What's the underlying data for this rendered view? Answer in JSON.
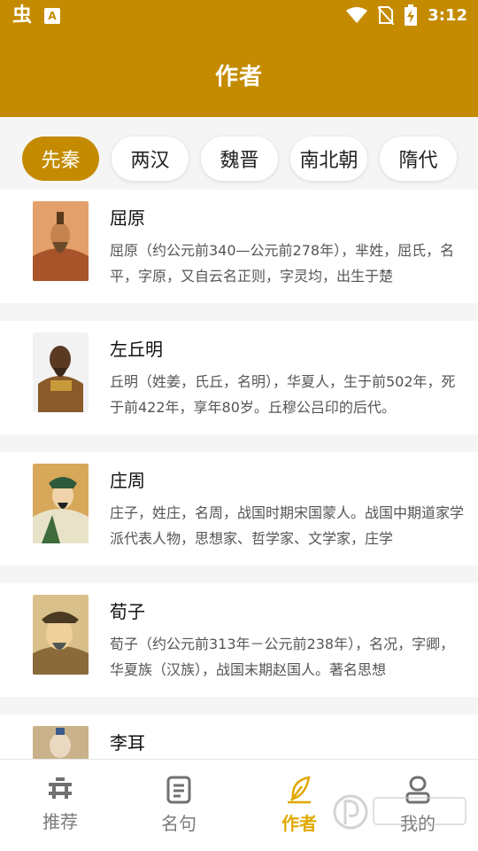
{
  "status_bar": {
    "time": "3:12",
    "badge": "A"
  },
  "header": {
    "title": "作者"
  },
  "dynasty_tabs": [
    {
      "label": "先秦",
      "active": true
    },
    {
      "label": "两汉",
      "active": false
    },
    {
      "label": "魏晋",
      "active": false
    },
    {
      "label": "南北朝",
      "active": false
    },
    {
      "label": "隋代",
      "active": false
    }
  ],
  "authors": [
    {
      "name": "屈原",
      "desc": "屈原（约公元前340—公元前278年），芈姓，屈氏，名平，字原，又自云名正则，字灵均，出生于楚"
    },
    {
      "name": "左丘明",
      "desc": "丘明（姓姜，氏丘，名明），华夏人，生于前502年，死于前422年，享年80岁。丘穆公吕印的后代。"
    },
    {
      "name": "庄周",
      "desc": "庄子，姓庄，名周，战国时期宋国蒙人。战国中期道家学派代表人物，思想家、哲学家、文学家，庄学"
    },
    {
      "name": "荀子",
      "desc": "荀子（约公元前313年－公元前238年），名况，字卿，华夏族（汉族），战国末期赵国人。著名思想"
    },
    {
      "name": "李耳",
      "desc": ""
    }
  ],
  "bottom_nav": [
    {
      "label": "推荐",
      "icon": "recommend-icon",
      "active": false
    },
    {
      "label": "名句",
      "icon": "document-icon",
      "active": false
    },
    {
      "label": "作者",
      "icon": "quill-icon",
      "active": true
    },
    {
      "label": "我的",
      "icon": "profile-icon",
      "active": false
    }
  ],
  "colors": {
    "brand": "#c48b00",
    "active_nav": "#e0a800"
  }
}
